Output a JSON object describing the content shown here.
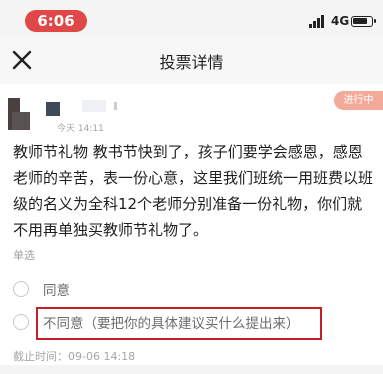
{
  "status_bar": {
    "time": "6:06",
    "network": "4G",
    "signal_icon": "signal-bars-icon",
    "battery_icon": "battery-icon",
    "battery_level": 0.8,
    "accent_color": "#e04848"
  },
  "nav": {
    "title": "投票详情",
    "close_icon": "close-icon"
  },
  "post": {
    "time": "今天 14:11",
    "status_badge": "进行中",
    "description": "教师节礼物 教书节快到了，孩子们要学会感恩，感恩老师的辛苦，表一份心意，这里我们班统一用班费以班级的名义为全科12个老师分别准备一份礼物，你们就不用再单独买教师节礼物了。"
  },
  "vote": {
    "type_label": "单选",
    "options": [
      {
        "label": "同意"
      },
      {
        "label": "不同意（要把你的具体建议买什么提出来）"
      }
    ],
    "deadline": "截止时间：09-06 14:18"
  },
  "colors": {
    "badge": "#f4aa99",
    "highlight": "#c51e28"
  }
}
